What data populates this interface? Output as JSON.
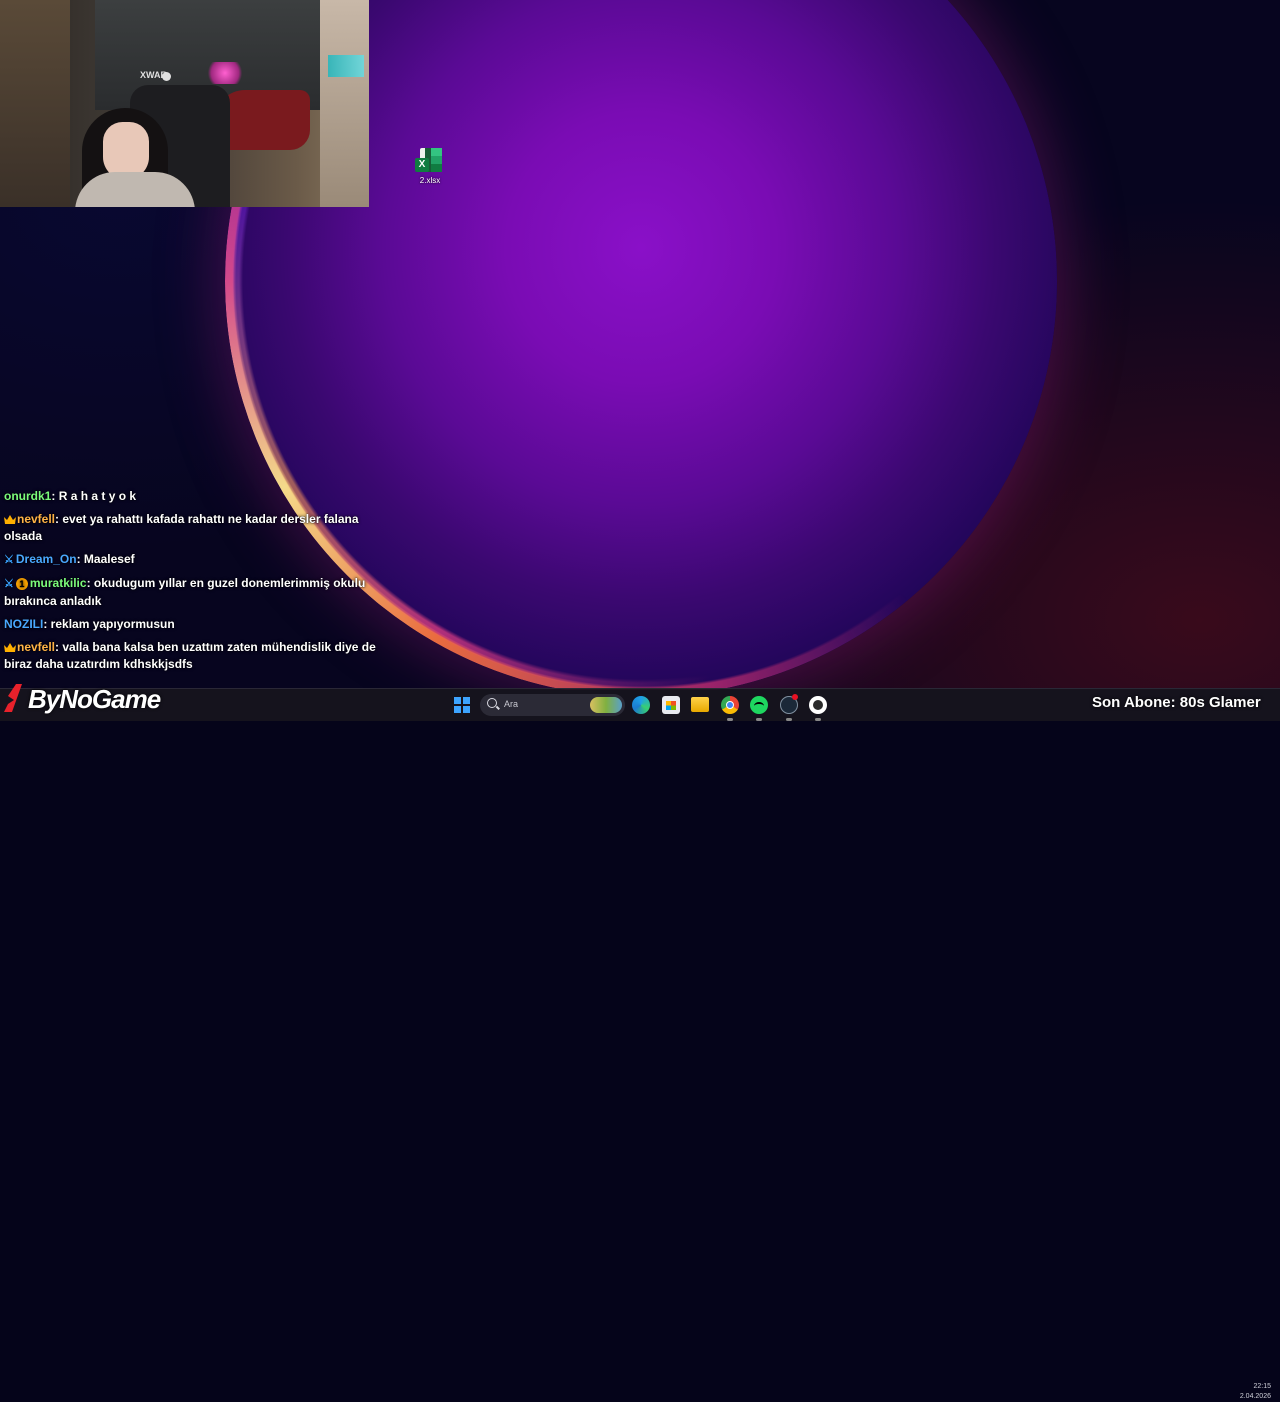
{
  "desktop": {
    "icons": [
      {
        "label": "2.xlsx",
        "icon": "excel-file-icon"
      }
    ]
  },
  "webcam": {
    "logo_text": "XWAR"
  },
  "chat": {
    "messages": [
      {
        "user": "onurdk1",
        "user_color": "#7cfc7c",
        "badges": [],
        "text": "R a h a t y o k"
      },
      {
        "user": "nevfell",
        "user_color": "#ffb347",
        "badges": [
          "crown"
        ],
        "text": "evet ya rahattı kafada rahattı ne kadar dersler falana olsada"
      },
      {
        "user": "Dream_On",
        "user_color": "#4aa8ff",
        "badges": [
          "sword"
        ],
        "text": "Maalesef"
      },
      {
        "user": "muratkilic",
        "user_color": "#7cfc7c",
        "badges": [
          "sword",
          "one"
        ],
        "text": "okudugum yıllar en guzel donemlerimmiş okulu bırakınca anladık"
      },
      {
        "user": "NOZILI",
        "user_color": "#4aa8ff",
        "badges": [],
        "text": "reklam yapıyormusun"
      },
      {
        "user": "nevfell",
        "user_color": "#ffb347",
        "badges": [
          "crown"
        ],
        "text": "valla bana kalsa ben uzattım zaten mühendislik diye de biraz daha uzatırdım kdhskkjsdfs"
      }
    ]
  },
  "overlay": {
    "brand": "ByNoGame",
    "last_subscriber": "Son Abone: 80s Glamer"
  },
  "taskbar": {
    "search_placeholder": "Ara",
    "clock_time": "22:15",
    "clock_date": "2.04.2026",
    "apps": [
      "start-icon",
      "edge-icon",
      "store-icon",
      "file-explorer-icon",
      "chrome-icon",
      "spotify-icon",
      "steam-icon",
      "obs-icon"
    ]
  },
  "colors": {
    "crown": "#ffb000",
    "sword": "#39a0ff",
    "start": "#3da4ff"
  }
}
